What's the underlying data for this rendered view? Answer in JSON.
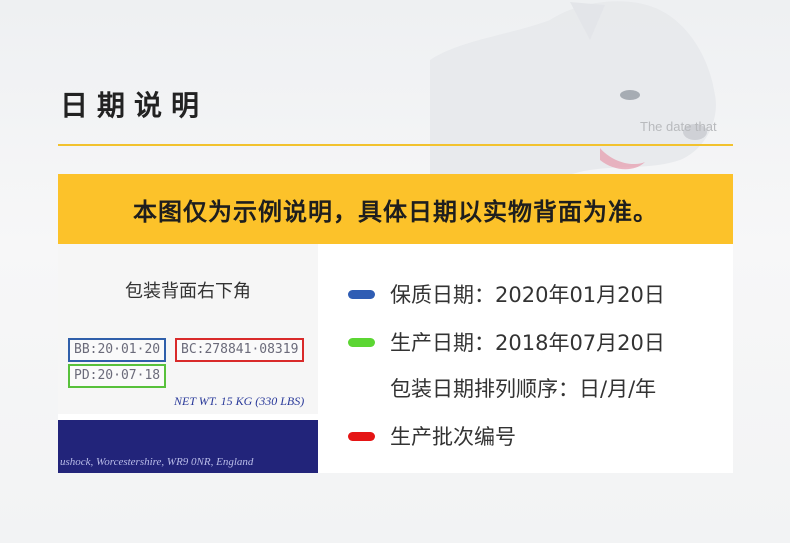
{
  "header": {
    "title": "日期说明",
    "subtitle": "The date that"
  },
  "banner": {
    "text": "本图仅为示例说明，具体日期以实物背面为准。"
  },
  "photo": {
    "caption": "包装背面右下角",
    "stamp_bb": "BB:20·01·20",
    "stamp_bc": "BC:278841·08319",
    "stamp_pd": "PD:20·07·18",
    "net_weight": "NET WT. 15 KG (330 LBS)",
    "address": "ushock, Worcestershire, WR9 0NR, England"
  },
  "legend": [
    {
      "color": "#2f5db4",
      "label": "保质日期：2020年01月20日"
    },
    {
      "color": "#5cd633",
      "label": "生产日期：2018年07月20日"
    },
    {
      "color": "",
      "label": "包装日期排列顺序：日/月/年"
    },
    {
      "color": "#e51515",
      "label": "生产批次编号"
    }
  ],
  "colors": {
    "accent": "#fcc22a",
    "blue_marker": "#2f5db4",
    "green_marker": "#5cd633",
    "red_marker": "#e51515"
  }
}
